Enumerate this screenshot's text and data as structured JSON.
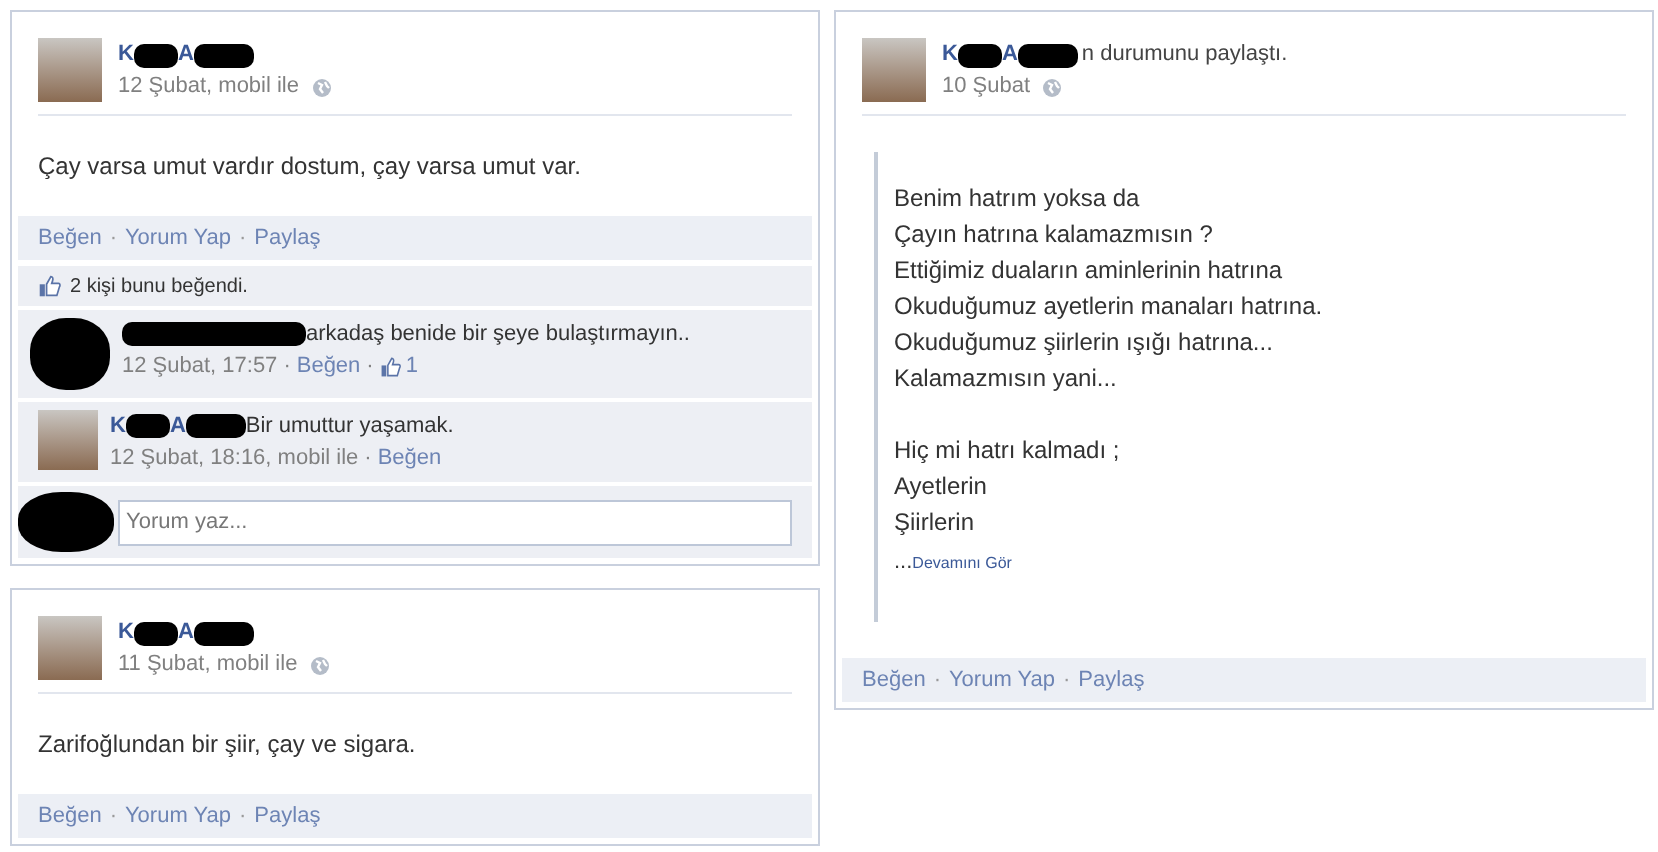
{
  "left_column": [
    {
      "author": [
        {
          "kind": "text",
          "text": "K"
        },
        {
          "kind": "redacted"
        },
        {
          "kind": "text",
          "text": "A"
        },
        {
          "kind": "redacted"
        }
      ],
      "meta": "12 Şubat, mobil ile",
      "body": [
        [
          "Çay varsa umut vardır dostum, çay varsa umut var."
        ]
      ],
      "quoted": false,
      "actions": [
        "Beğen",
        "Yorum Yap",
        "Paylaş"
      ],
      "separator": "·",
      "likes": "2 kişi bunu beğendi.",
      "comments": [
        {
          "kind": "redacted",
          "author": [
            {
              "kind": "redacted"
            }
          ],
          "text": "arkadaş benide bir şeye bulaştırmayın..",
          "time": "12 Şubat, 17:57",
          "like_link": "Beğen",
          "like_count": "1"
        },
        {
          "kind": "photo",
          "author": [
            {
              "kind": "text",
              "text": "K"
            },
            {
              "kind": "redacted"
            },
            {
              "kind": "text",
              "text": "A"
            },
            {
              "kind": "redacted"
            }
          ],
          "text": "Bir umuttur yaşamak.",
          "time": "12 Şubat, 18:16, mobil ile",
          "like_link": "Beğen"
        }
      ],
      "comment_input": {
        "placeholder": "Yorum yaz..."
      }
    },
    {
      "author": [
        {
          "kind": "text",
          "text": "K"
        },
        {
          "kind": "redacted"
        },
        {
          "kind": "text",
          "text": "A"
        },
        {
          "kind": "redacted"
        }
      ],
      "meta": "11 Şubat, mobil ile",
      "body": [
        [
          "Zarifoğlundan bir şiir, çay ve sigara."
        ]
      ],
      "quoted": false,
      "actions": [
        "Beğen",
        "Yorum Yap",
        "Paylaş"
      ],
      "separator": "·"
    }
  ],
  "right_column": [
    {
      "author": [
        {
          "kind": "text",
          "text": "K"
        },
        {
          "kind": "redacted"
        },
        {
          "kind": "text",
          "text": "A"
        },
        {
          "kind": "redacted"
        }
      ],
      "shared_note": "n durumunu paylaştı.",
      "meta": "10 Şubat",
      "quoted": true,
      "body": [
        [
          "Benim hatrım yoksa da",
          "Çayın hatrına kalamazmısın ?",
          "Ettiğimiz duaların aminlerinin hatrına",
          "Okuduğumuz ayetlerin manaları hatrına.",
          "Okuduğumuz şiirlerin ışığı hatrına...",
          "Kalamazmısın yani..."
        ],
        [
          "Hiç mi hatrı kalmadı ;",
          "Ayetlerin",
          "Şiirlerin"
        ]
      ],
      "ellipsis": "...",
      "see_more": "Devamını Gör",
      "actions": [
        "Beğen",
        "Yorum Yap",
        "Paylaş"
      ],
      "separator": "·"
    }
  ]
}
